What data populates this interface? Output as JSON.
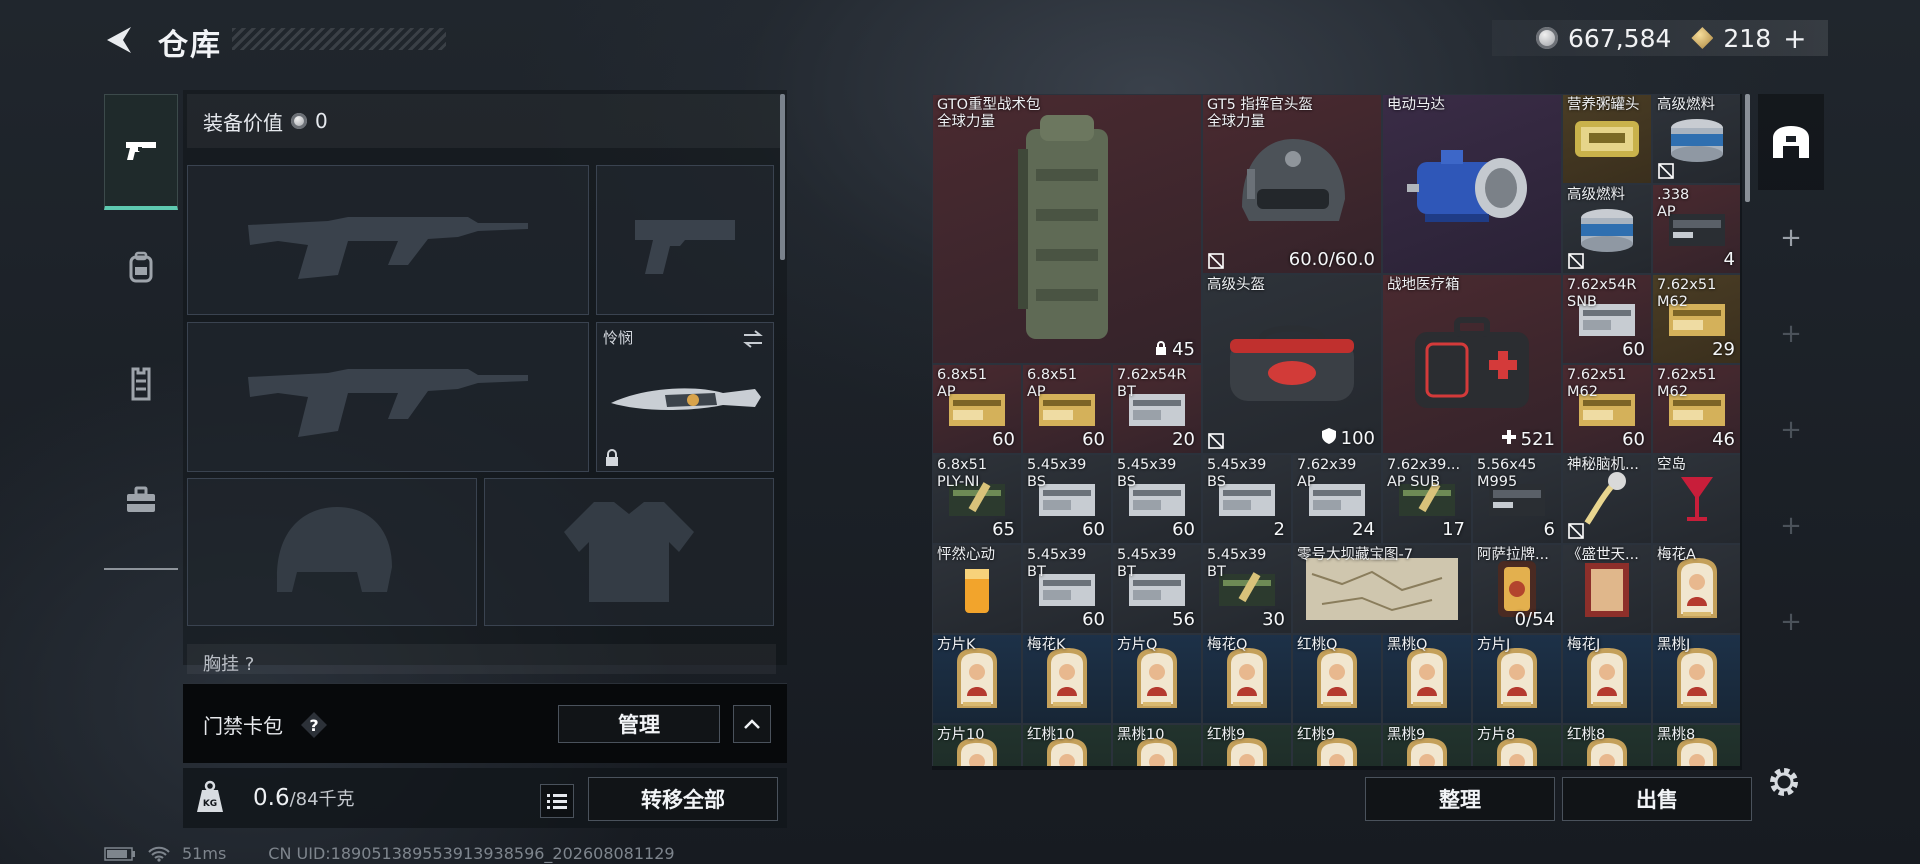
{
  "header": {
    "title": "仓库",
    "currency_silver": "667,584",
    "currency_gold": "218",
    "plus": "+"
  },
  "left_tabs": [
    {
      "name": "weapons-tab",
      "icon": "pistol-icon",
      "active": true
    },
    {
      "name": "gear-tab",
      "icon": "backpack-icon",
      "active": false
    },
    {
      "name": "vest-tab",
      "icon": "vest-icon",
      "active": false
    },
    {
      "name": "toolbox-tab",
      "icon": "toolbox-icon",
      "active": false
    }
  ],
  "equipment": {
    "value_label": "装备价值",
    "value": "0",
    "melee_label": "怜悯",
    "chest_label": "胸挂 ?"
  },
  "access_card": {
    "label": "门禁卡包",
    "help": "?",
    "manage_label": "管理"
  },
  "weight": {
    "current": "0.6",
    "capacity": "/84千克",
    "transfer_all_label": "转移全部"
  },
  "status": {
    "ping": "51ms",
    "uid": "CN UID:189051389553913938596_202608081129"
  },
  "inventory_actions": {
    "sort_label": "整理",
    "sell_label": "出售"
  },
  "inventory": [
    {
      "name": "GTO重型战术包\n全球力量",
      "count": "45",
      "badge": "lock",
      "bg": "red",
      "icon": "backpack"
    },
    {
      "name": "GT5 指挥官头盔\n全球力量",
      "count": "60.0/60.0",
      "bg": "red",
      "icon": "helmet",
      "nolist": true
    },
    {
      "name": "电动马达",
      "count": "",
      "bg": "purple",
      "icon": "motor"
    },
    {
      "name": "营养粥罐头",
      "count": "",
      "bg": "gold",
      "icon": "can"
    },
    {
      "name": "高级燃料",
      "count": "",
      "bg": "gray",
      "icon": "fuel",
      "nolist": true
    },
    {
      "name": "高级燃料",
      "count": "",
      "bg": "gray",
      "icon": "fuel",
      "nolist": true
    },
    {
      "name": ".338\nAP",
      "count": "4",
      "bg": "red",
      "icon": "ammo-dark"
    },
    {
      "name": "高级头盔",
      "count": "100",
      "badge": "shield",
      "bg": "gray",
      "icon": "bag",
      "nolist": true
    },
    {
      "name": "战地医疗箱",
      "count": "521",
      "badge": "cross",
      "bg": "red",
      "icon": "medkit"
    },
    {
      "name": "7.62x54R\nSNB",
      "count": "60",
      "bg": "red",
      "icon": "ammo-light"
    },
    {
      "name": "7.62x51\nM62",
      "count": "29",
      "bg": "gold",
      "icon": "ammo-gold"
    },
    {
      "name": "6.8x51\nAP",
      "count": "60",
      "bg": "red",
      "icon": "ammo-gold"
    },
    {
      "name": "6.8x51\nAP",
      "count": "60",
      "bg": "red",
      "icon": "ammo-gold"
    },
    {
      "name": "7.62x54R\nBT",
      "count": "20",
      "bg": "red",
      "icon": "ammo-light"
    },
    {
      "name": "7.62x51\nM62",
      "count": "60",
      "bg": "red",
      "icon": "ammo-gold"
    },
    {
      "name": "7.62x51\nM62",
      "count": "46",
      "bg": "red",
      "icon": "ammo-gold"
    },
    {
      "name": "6.8x51\nPLY-NI",
      "count": "65",
      "bg": "gray",
      "icon": "ammo-green"
    },
    {
      "name": "5.45x39\nBS",
      "count": "60",
      "bg": "gray",
      "icon": "ammo-light"
    },
    {
      "name": "5.45x39\nBS",
      "count": "60",
      "bg": "gray",
      "icon": "ammo-light"
    },
    {
      "name": "5.45x39\nBS",
      "count": "2",
      "bg": "gray",
      "icon": "ammo-light"
    },
    {
      "name": "7.62x39\nAP",
      "count": "24",
      "bg": "gray",
      "icon": "ammo-light"
    },
    {
      "name": "7.62x39...\nAP SUB",
      "count": "17",
      "bg": "gray",
      "icon": "ammo-green"
    },
    {
      "name": "5.56x45\nM995",
      "count": "6",
      "bg": "gray",
      "icon": "ammo-dark"
    },
    {
      "name": "神秘脑机...",
      "count": "",
      "bg": "gray",
      "icon": "brain",
      "nolist": true
    },
    {
      "name": "空岛",
      "count": "",
      "bg": "gray",
      "icon": "cocktail"
    },
    {
      "name": "怦然心动",
      "count": "",
      "bg": "gray",
      "icon": "drink"
    },
    {
      "name": "5.45x39\nBT",
      "count": "60",
      "bg": "gray",
      "icon": "ammo-light"
    },
    {
      "name": "5.45x39\nBT",
      "count": "56",
      "bg": "gray",
      "icon": "ammo-light"
    },
    {
      "name": "5.45x39\nBT",
      "count": "30",
      "bg": "gray",
      "icon": "ammo-green"
    },
    {
      "name": "零号大坝藏宝图-7",
      "count": "",
      "bg": "gray",
      "icon": "map"
    },
    {
      "name": "阿萨拉牌...",
      "count": "0/54",
      "bg": "gray",
      "icon": "cardbox"
    },
    {
      "name": "《盛世天...",
      "count": "",
      "bg": "gray",
      "icon": "poster"
    },
    {
      "name": "梅花A",
      "count": "",
      "bg": "gray",
      "icon": "card"
    },
    {
      "name": "方片K",
      "count": "",
      "bg": "card",
      "icon": "card"
    },
    {
      "name": "梅花K",
      "count": "",
      "bg": "card",
      "icon": "card"
    },
    {
      "name": "方片Q",
      "count": "",
      "bg": "card",
      "icon": "card"
    },
    {
      "name": "梅花Q",
      "count": "",
      "bg": "card",
      "icon": "card"
    },
    {
      "name": "红桃Q",
      "count": "",
      "bg": "card",
      "icon": "card"
    },
    {
      "name": "黑桃Q",
      "count": "",
      "bg": "card",
      "icon": "card"
    },
    {
      "name": "方片J",
      "count": "",
      "bg": "card",
      "icon": "card"
    },
    {
      "name": "梅花J",
      "count": "",
      "bg": "card",
      "icon": "card"
    },
    {
      "name": "黑桃J",
      "count": "",
      "bg": "card",
      "icon": "card"
    },
    {
      "name": "方片10",
      "count": "",
      "bg": "gcard",
      "icon": "card"
    },
    {
      "name": "红桃10",
      "count": "",
      "bg": "gcard",
      "icon": "card"
    },
    {
      "name": "黑桃10",
      "count": "",
      "bg": "gcard",
      "icon": "card"
    },
    {
      "name": "红桃9",
      "count": "",
      "bg": "gcard",
      "icon": "card"
    },
    {
      "name": "红桃9",
      "count": "",
      "bg": "gcard",
      "icon": "card"
    },
    {
      "name": "黑桃9",
      "count": "",
      "bg": "gcard",
      "icon": "card"
    },
    {
      "name": "方片8",
      "count": "",
      "bg": "gcard",
      "icon": "card"
    },
    {
      "name": "红桃8",
      "count": "",
      "bg": "gcard",
      "icon": "card"
    },
    {
      "name": "黑桃8",
      "count": "",
      "bg": "gcard",
      "icon": "card"
    }
  ]
}
